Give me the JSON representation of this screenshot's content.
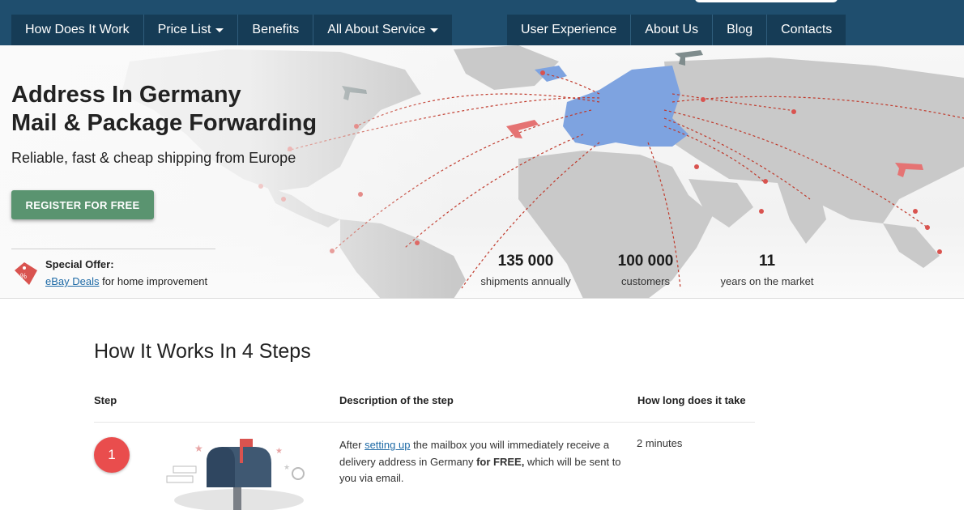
{
  "nav": {
    "left": [
      {
        "label": "How Does It Work",
        "has_dropdown": false
      },
      {
        "label": "Price List",
        "has_dropdown": true
      },
      {
        "label": "Benefits",
        "has_dropdown": false
      },
      {
        "label": "All About Service",
        "has_dropdown": true
      }
    ],
    "right": [
      {
        "label": "User Experience"
      },
      {
        "label": "About Us"
      },
      {
        "label": "Blog"
      },
      {
        "label": "Contacts"
      }
    ]
  },
  "hero": {
    "title_line1": "Address In Germany",
    "title_line2": "Mail & Package Forwarding",
    "subtitle": "Reliable, fast & cheap shipping from Europe",
    "register_label": "REGISTER FOR FREE",
    "offer": {
      "icon": "discount-tag-icon",
      "label": "Special Offer:",
      "link_text": "eBay Deals",
      "text_after": " for home improvement"
    },
    "stats": [
      {
        "number": "135 000",
        "label": "shipments annually"
      },
      {
        "number": "100 000",
        "label": "customers"
      },
      {
        "number": "11",
        "label": "years on the market"
      }
    ]
  },
  "steps": {
    "title": "How It Works In 4 Steps",
    "columns": [
      "Step",
      "Description of the step",
      "How long does it take"
    ],
    "rows": [
      {
        "number": "1",
        "icon": "mailbox-icon",
        "desc_before": "After ",
        "desc_link": "setting up",
        "desc_middle": " the mailbox you will immediately receive a delivery address in Germany ",
        "desc_bold": "for FREE,",
        "desc_after": " which will be sent to you via email.",
        "time": "2 minutes"
      }
    ]
  },
  "colors": {
    "nav_bar": "#1f4e6e",
    "nav_item": "#163c56",
    "register_button": "#5a9470",
    "step_badge": "#e94d4d",
    "link": "#1e6aa6",
    "europe_highlight": "#7ea3e0",
    "route_line": "#c0392b"
  }
}
